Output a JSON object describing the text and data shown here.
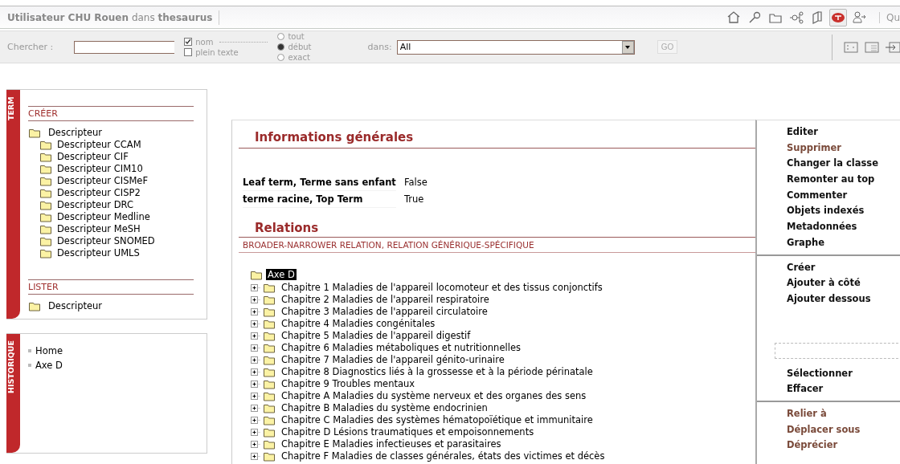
{
  "header": {
    "user_label": "Utilisateur",
    "user": "CHU Rouen",
    "in_label": "dans",
    "thesaurus": "thesaurus",
    "tools": [
      {
        "kind": "home",
        "selected": false
      },
      {
        "kind": "key",
        "selected": false
      },
      {
        "kind": "folder",
        "selected": false
      },
      {
        "kind": "network",
        "selected": false
      },
      {
        "kind": "book",
        "selected": false
      },
      {
        "kind": "term",
        "selected": true
      },
      {
        "kind": "user",
        "selected": false
      }
    ],
    "cut_text": "Qu"
  },
  "search": {
    "label": "Chercher :",
    "scopes": [
      {
        "label": "nom",
        "checked": true
      },
      {
        "label": "plein texte",
        "checked": false
      }
    ],
    "match": [
      {
        "label": "tout",
        "selected": false
      },
      {
        "label": "début",
        "selected": true
      },
      {
        "label": "exact",
        "selected": false
      }
    ],
    "in_label": "dans:",
    "in_value": "All",
    "go": "GO",
    "views": [
      {
        "kind": "list"
      },
      {
        "kind": "page"
      },
      {
        "kind": "export"
      }
    ]
  },
  "term_panel": {
    "tab": "TERM",
    "sections": [
      {
        "title": "CRÉER",
        "items": [
          {
            "label": "Descripteur",
            "children": [
              {
                "label": "Descripteur CCAM"
              },
              {
                "label": "Descripteur CIF"
              },
              {
                "label": "Descripteur CIM10"
              },
              {
                "label": "Descripteur CISMeF"
              },
              {
                "label": "Descripteur CISP2"
              },
              {
                "label": "Descripteur DRC"
              },
              {
                "label": "Descripteur Medline"
              },
              {
                "label": "Descripteur MeSH"
              },
              {
                "label": "Descripteur SNOMED"
              },
              {
                "label": "Descripteur UMLS"
              }
            ]
          }
        ]
      },
      {
        "title": "LISTER",
        "items": [
          {
            "label": "Descripteur"
          }
        ]
      }
    ]
  },
  "history_panel": {
    "tab": "HISTORIQUE",
    "items": [
      "Home",
      "Axe D"
    ]
  },
  "info": {
    "title": "Informations générales",
    "properties": [
      {
        "label": "Leaf term, Terme sans enfant",
        "value": "False"
      },
      {
        "label": "terme racine, Top Term",
        "value": "True"
      }
    ]
  },
  "relations": {
    "title": "Relations",
    "type": "BROADER-NARROWER RELATION, RELATION GÉNÉRIQUE-SPÉCIFIQUE",
    "tree": {
      "label": "Axe D",
      "selected": true,
      "children": [
        {
          "label": "Chapitre 1 Maladies de l'appareil locomoteur et des tissus conjonctifs",
          "expanded": false
        },
        {
          "label": "Chapitre 2 Maladies de l'appareil respiratoire",
          "expanded": false
        },
        {
          "label": "Chapitre 3 Maladies de l'appareil circulatoire",
          "expanded": false
        },
        {
          "label": "Chapitre 4 Maladies congénitales",
          "expanded": false
        },
        {
          "label": "Chapitre 5 Maladies de l'appareil digestif",
          "expanded": false
        },
        {
          "label": "Chapitre 6 Maladies métaboliques et nutritionnelles",
          "expanded": false
        },
        {
          "label": "Chapitre 7 Maladies de l'appareil génito-urinaire",
          "expanded": false
        },
        {
          "label": "Chapitre 8 Diagnostics liés à la grossesse et à la période périnatale",
          "expanded": false
        },
        {
          "label": "Chapitre 9 Troubles mentaux",
          "expanded": false
        },
        {
          "label": "Chapitre A Maladies du système nerveux et des organes des sens",
          "expanded": false
        },
        {
          "label": "Chapitre B Maladies du système endocrinien",
          "expanded": false
        },
        {
          "label": "Chapitre C Maladies des systèmes hématopoïétique et immunitaire",
          "expanded": false
        },
        {
          "label": "Chapitre D Lésions traumatiques et empoisonnements",
          "expanded": false
        },
        {
          "label": "Chapitre E Maladies infectieuses et parasitaires",
          "expanded": false
        },
        {
          "label": "Chapitre F Maladies de classes générales, états des victimes et décès",
          "expanded": false
        }
      ]
    }
  },
  "actions": [
    {
      "kind": "menu",
      "items": [
        {
          "label": "Editer",
          "disabled": false
        },
        {
          "label": "Supprimer",
          "disabled": true
        },
        {
          "label": "Changer la classe",
          "disabled": false
        },
        {
          "label": "Remonter au top",
          "disabled": false
        },
        {
          "label": "Commenter",
          "disabled": false
        },
        {
          "label": "Objets indexés",
          "disabled": false
        },
        {
          "label": "Metadonnées",
          "disabled": false
        },
        {
          "label": "Graphe",
          "disabled": false
        }
      ]
    },
    {
      "kind": "menu",
      "items": [
        {
          "label": "Créer",
          "disabled": false
        },
        {
          "label": "Ajouter à côté",
          "disabled": false
        },
        {
          "label": "Ajouter dessous",
          "disabled": false
        }
      ]
    },
    {
      "kind": "dropzone",
      "items": [
        {
          "label": "Sélectionner",
          "disabled": false
        },
        {
          "label": "Effacer",
          "disabled": false
        }
      ]
    },
    {
      "kind": "menu",
      "items": [
        {
          "label": "Relier à",
          "disabled": true
        },
        {
          "label": "Déplacer sous",
          "disabled": true
        },
        {
          "label": "Déprécier",
          "disabled": true
        }
      ]
    }
  ]
}
